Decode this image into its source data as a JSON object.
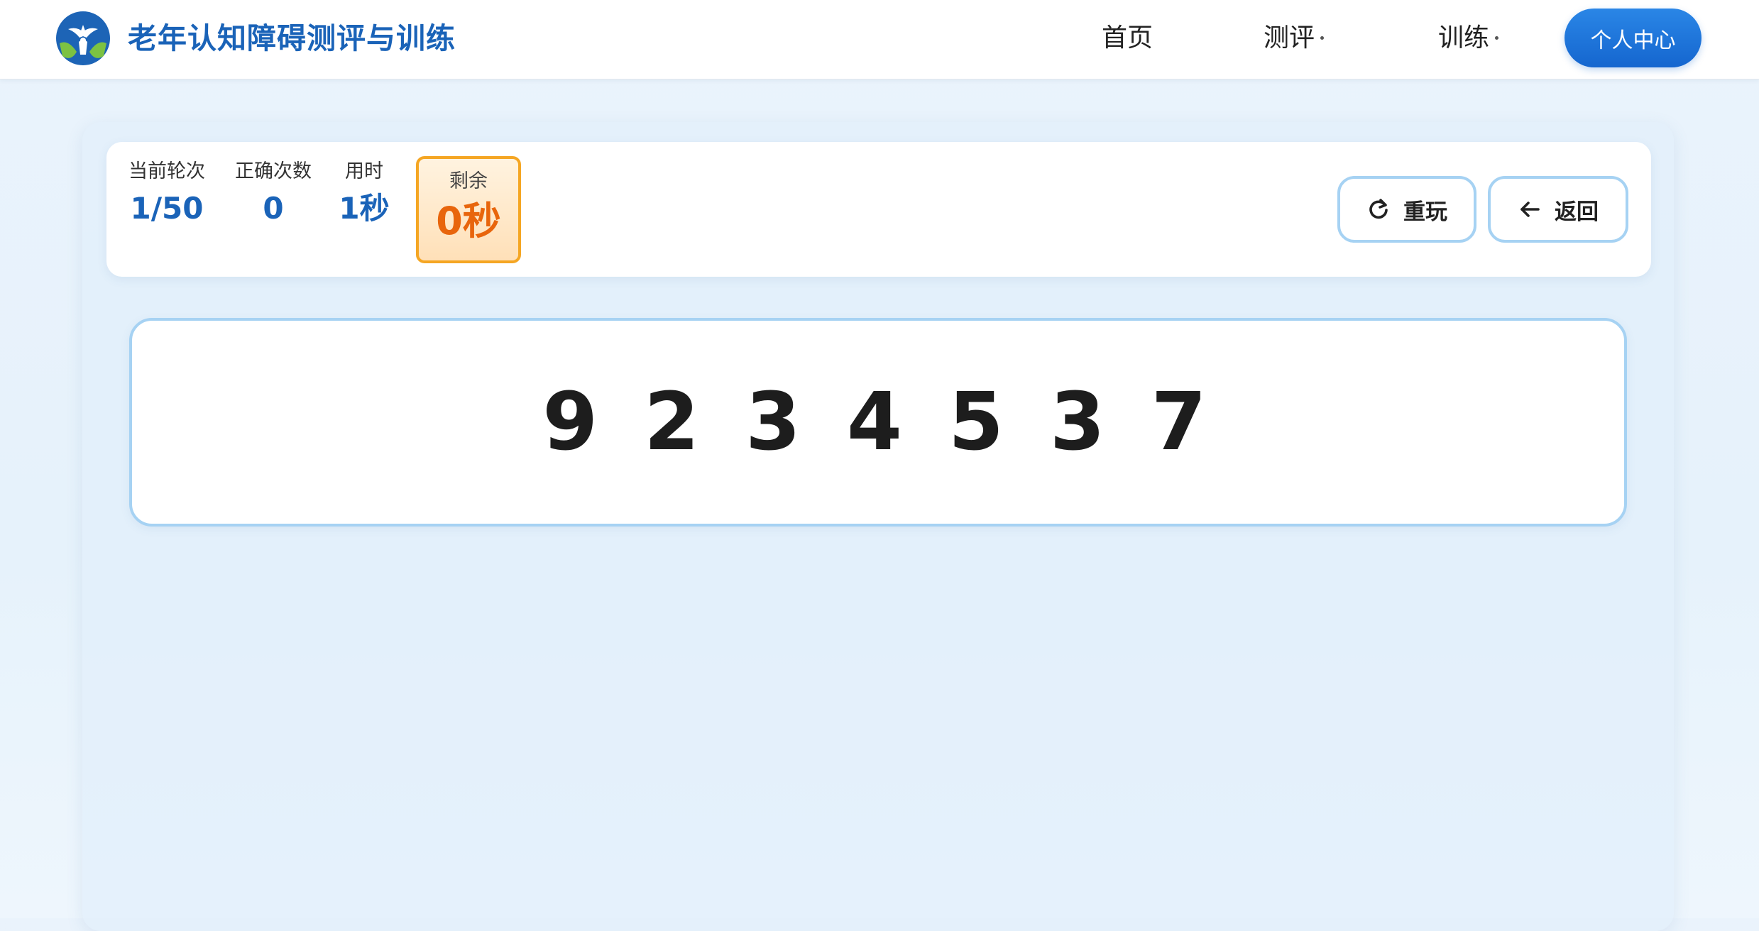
{
  "header": {
    "app_title": "老年认知障碍测评与训练",
    "nav": {
      "home": "首页",
      "assess": "测评",
      "train": "训练"
    },
    "profile_button": "个人中心"
  },
  "stats": {
    "round_label": "当前轮次",
    "round_value": "1/50",
    "correct_label": "正确次数",
    "correct_value": "0",
    "time_label": "用时",
    "time_value": "1秒",
    "remaining_label": "剩余",
    "remaining_value": "0秒"
  },
  "actions": {
    "replay": "重玩",
    "back": "返回"
  },
  "sequence": {
    "digits": "9 2 3 4 5 3 7"
  },
  "colors": {
    "brand_blue": "#1a63b8",
    "button_blue": "#1566cf",
    "warning_orange": "#e8650c",
    "warning_border": "#f5a623",
    "card_border": "#a6d2f3"
  }
}
